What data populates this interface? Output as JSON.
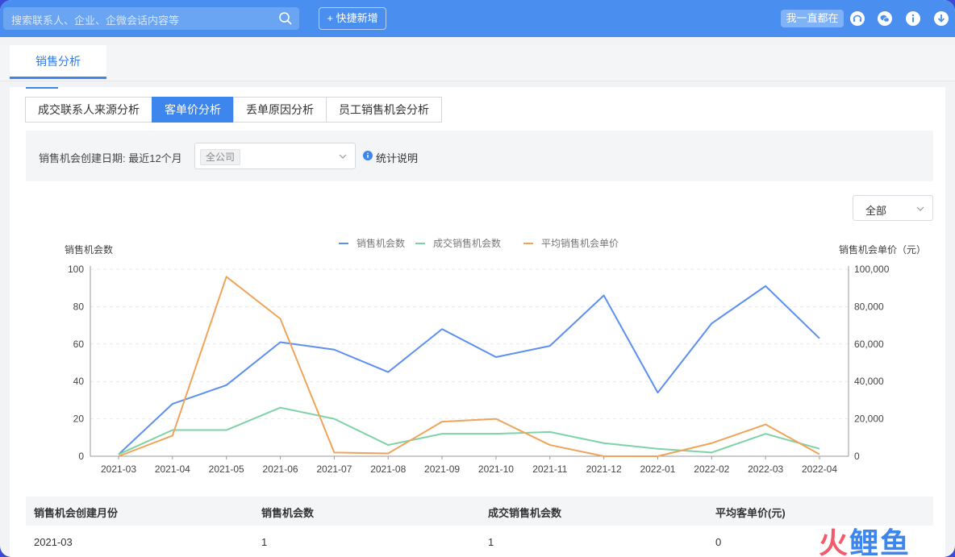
{
  "topbar": {
    "search_placeholder": "搜索联系人、企业、企微会话内容等",
    "quick_add": "+ 快捷新增",
    "status": "我一直都在"
  },
  "main_tab": "销售分析",
  "sub_tabs": [
    "成交联系人来源分析",
    "客单价分析",
    "丢单原因分析",
    "员工销售机会分析"
  ],
  "active_sub_tab": 1,
  "filter": {
    "date_label": "销售机会创建日期:  最近12个月",
    "scope": "全公司",
    "info": "统计说明"
  },
  "series_select": "全部",
  "chart_data": {
    "type": "line",
    "x": [
      "2021-03",
      "2021-04",
      "2021-05",
      "2021-06",
      "2021-07",
      "2021-08",
      "2021-09",
      "2021-10",
      "2021-11",
      "2021-12",
      "2022-01",
      "2022-02",
      "2022-03",
      "2022-04"
    ],
    "ylabel": "销售机会数",
    "y2label": "销售机会单价（元）",
    "ylim": [
      0,
      100
    ],
    "y2lim": [
      0,
      100000
    ],
    "yticks": [
      "0",
      "20",
      "40",
      "60",
      "80",
      "100"
    ],
    "y2ticks": [
      "0",
      "20,000",
      "40,000",
      "60,000",
      "80,000",
      "100,000"
    ],
    "grid": true,
    "legend": "top-center",
    "series": [
      {
        "name": "销售机会数",
        "axis": "left",
        "color": "#5b8ff0",
        "values": [
          1,
          28,
          38,
          61,
          57,
          45,
          68,
          53,
          59,
          86,
          34,
          71,
          91,
          63
        ]
      },
      {
        "name": "成交销售机会数",
        "axis": "left",
        "color": "#7dd3a6",
        "values": [
          1,
          14,
          14,
          26,
          20,
          6,
          12,
          12,
          13,
          7,
          4,
          2,
          12,
          4
        ]
      },
      {
        "name": "平均销售机会单价",
        "axis": "right",
        "color": "#f0a35a",
        "values": [
          0,
          11000,
          96000,
          73500,
          2000,
          1500,
          18500,
          20000,
          6000,
          0,
          0,
          7000,
          17000,
          1000
        ]
      }
    ]
  },
  "table": {
    "headers": [
      "销售机会创建月份",
      "销售机会数",
      "成交销售机会数",
      "平均客单价(元)"
    ],
    "rows": [
      [
        "2021-03",
        "1",
        "1",
        "0"
      ]
    ]
  },
  "logo": {
    "text": [
      "火",
      "鲤",
      "鱼"
    ],
    "colors": [
      "#f35a6c",
      "#3c86ee",
      "#3c86ee"
    ]
  }
}
